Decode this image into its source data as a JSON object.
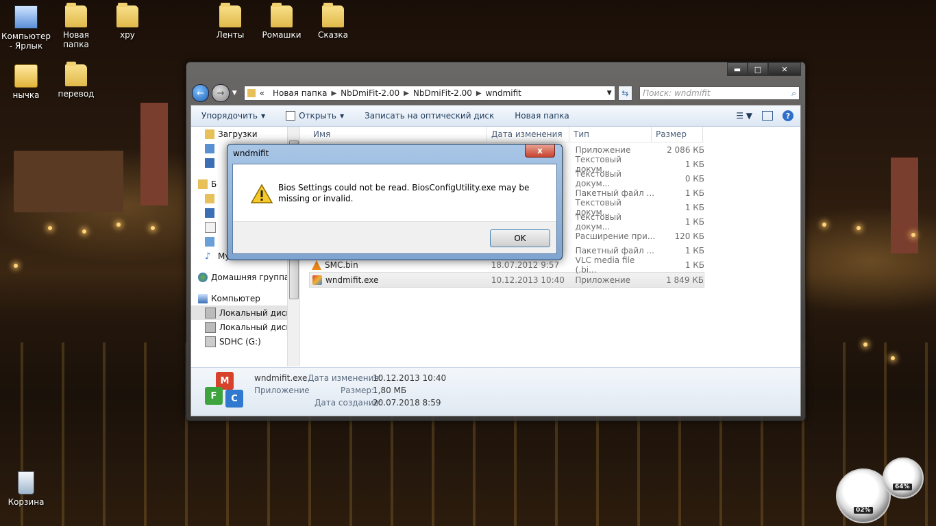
{
  "desktop": {
    "icons": [
      {
        "label": "Компьютер - Ярлык",
        "icon": "computer-shortcut-icon"
      },
      {
        "label": "Новая папка",
        "icon": "folder-icon"
      },
      {
        "label": "хру",
        "icon": "folder-icon"
      },
      {
        "label": "Ленты",
        "icon": "folder-icon"
      },
      {
        "label": "Ромашки",
        "icon": "folder-icon"
      },
      {
        "label": "Сказка",
        "icon": "folder-icon"
      },
      {
        "label": "нычка",
        "icon": "archive-icon"
      },
      {
        "label": "перевод",
        "icon": "folder-icon"
      },
      {
        "label": "Корзина",
        "icon": "recycle-bin-icon"
      }
    ]
  },
  "explorer": {
    "breadcrumb": [
      "«",
      "Новая папка",
      "NbDmiFit-2.00",
      "NbDmiFit-2.00",
      "wndmifit"
    ],
    "search_placeholder": "Поиск: wndmifit",
    "toolbar": {
      "organize": "Упорядочить",
      "open": "Открыть",
      "burn": "Записать на оптический диск",
      "new_folder": "Новая папка"
    },
    "nav": [
      {
        "label": "Загрузки",
        "icon": "downloads-icon"
      },
      {
        "label": "Б",
        "icon": "libraries-icon"
      },
      {
        "label": "Музыка",
        "icon": "music-icon"
      },
      {
        "label": "Домашняя группа",
        "icon": "homegroup-icon"
      },
      {
        "label": "Компьютер",
        "icon": "computer-icon"
      },
      {
        "label": "Локальный диск",
        "icon": "drive-icon"
      },
      {
        "label": "Локальный диск",
        "icon": "drive-icon"
      },
      {
        "label": "SDHC (G:)",
        "icon": "sd-card-icon"
      }
    ],
    "columns": [
      "Имя",
      "Дата изменения",
      "Тип",
      "Размер"
    ],
    "files": [
      {
        "name": "",
        "date": "",
        "type": "Приложение",
        "size": "2 086 КБ"
      },
      {
        "name": "",
        "date": "",
        "type": "Текстовый докум...",
        "size": "1 КБ"
      },
      {
        "name": "",
        "date": "",
        "type": "Текстовый докум...",
        "size": "0 КБ"
      },
      {
        "name": "",
        "date": "",
        "type": "Пакетный файл ...",
        "size": "1 КБ"
      },
      {
        "name": "",
        "date": "",
        "type": "Текстовый докум...",
        "size": "1 КБ"
      },
      {
        "name": "",
        "date": "",
        "type": "Текстовый докум...",
        "size": "1 КБ"
      },
      {
        "name": "",
        "date": "",
        "type": "Расширение при...",
        "size": "120 КБ"
      },
      {
        "name": "",
        "date": "",
        "type": "Пакетный файл ...",
        "size": "1 КБ"
      },
      {
        "name": "SMC.bin",
        "date": "18.07.2012 9:57",
        "type": "VLC media file (.bi...",
        "size": "1 КБ"
      },
      {
        "name": "wndmifit.exe",
        "date": "10.12.2013 10:40",
        "type": "Приложение",
        "size": "1 849 КБ"
      }
    ],
    "details": {
      "filename": "wndmifit.exe",
      "kind": "Приложение",
      "modified_label": "Дата изменения:",
      "modified_value": "10.12.2013 10:40",
      "size_label": "Размер:",
      "size_value": "1,80 МБ",
      "created_label": "Дата создания:",
      "created_value": "20.07.2018 8:59",
      "cube_letters": [
        "M",
        "F",
        "C"
      ]
    }
  },
  "dialog": {
    "title": "wndmifit",
    "message": "Bios Settings could not be read.  BiosConfigUtility.exe may be missing or invalid.",
    "ok": "OK",
    "close": "x"
  },
  "gadget": {
    "cpu": "02%",
    "ram": "64%"
  }
}
